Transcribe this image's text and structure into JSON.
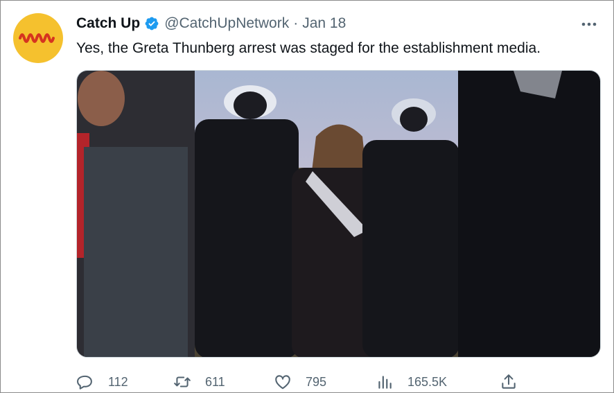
{
  "tweet": {
    "author_name": "Catch Up",
    "author_handle": "@CatchUpNetwork",
    "separator": "·",
    "date": "Jan 18",
    "text": "Yes, the Greta Thunberg arrest was staged for the establishment media."
  },
  "actions": {
    "reply_count": "112",
    "retweet_count": "611",
    "like_count": "795",
    "views_count": "165.5K"
  },
  "colors": {
    "avatar_bg": "#f5c12e",
    "avatar_logo": "#d6341f",
    "verified": "#1d9bf0",
    "secondary_text": "#536471",
    "primary_text": "#0f1419"
  },
  "icons": {
    "verified": "verified-badge-icon",
    "more": "more-dots-icon",
    "reply": "reply-icon",
    "retweet": "retweet-icon",
    "like": "heart-icon",
    "views": "views-chart-icon",
    "share": "share-icon"
  }
}
